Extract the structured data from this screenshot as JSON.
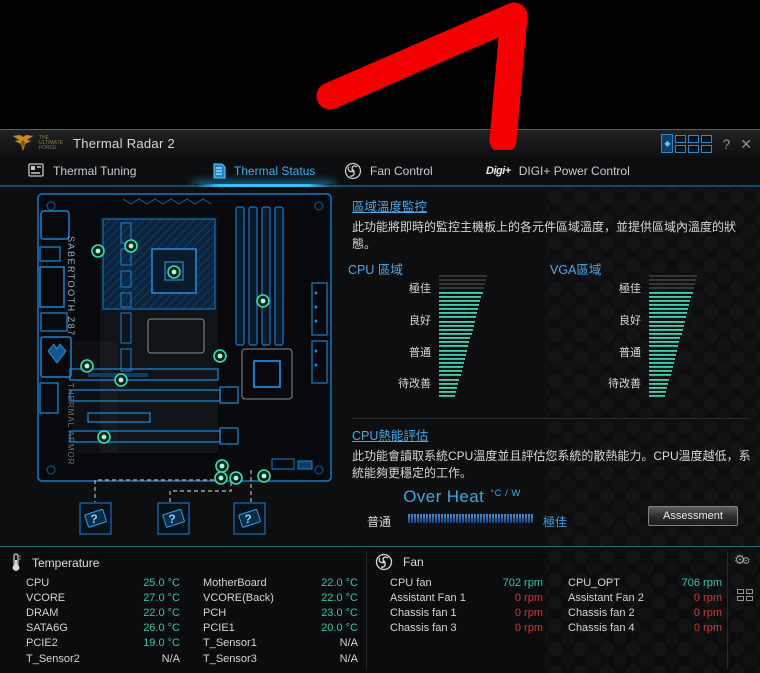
{
  "annotation": {
    "type": "arrow-stroke",
    "color": "#f40000"
  },
  "window": {
    "title": "Thermal Radar 2",
    "logo_sub": "THE ULTIMATE FORCE",
    "panel_selector_glyph": "◆",
    "controls": {
      "help": "?",
      "close": "✕"
    },
    "tabs": [
      {
        "label": "Thermal Tuning",
        "active": false
      },
      {
        "label": "Thermal Status",
        "active": true
      },
      {
        "label": "Fan Control",
        "active": false
      },
      {
        "label": "DIGI+ Power Control",
        "active": false
      }
    ],
    "digi_logo": "Digi+"
  },
  "board": {
    "name": "SABERTOOTH Z87",
    "armor_label": "THERMAL ARMOR",
    "unknown_boxes": [
      "?",
      "?",
      "?"
    ]
  },
  "region_monitor": {
    "title": "區域溫度監控",
    "description": "此功能將即時的監控主機板上的各元件區域溫度，並提供區域內溫度的狀態。",
    "meters": [
      {
        "label": "CPU 區域",
        "levels": [
          "極佳",
          "良好",
          "普通",
          "待改善"
        ]
      },
      {
        "label": "VGA區域",
        "levels": [
          "極佳",
          "良好",
          "普通",
          "待改善"
        ]
      }
    ]
  },
  "thermal_assessment": {
    "title": "CPU熱能評估",
    "description": "此功能會讀取系統CPU溫度並且評估您系統的散熱能力。CPU溫度越低，系統能夠更穩定的工作。",
    "gauge_title": "Over Heat",
    "gauge_unit": "°C / W",
    "scale_left": "普通",
    "scale_right": "極佳",
    "button_label": "Assessment"
  },
  "temperature": {
    "title": "Temperature",
    "rows": [
      {
        "l1": "CPU",
        "v1": "25.0 °C",
        "c1": "teal",
        "l2": "MotherBoard",
        "v2": "22.0 °C",
        "c2": "teal"
      },
      {
        "l1": "VCORE",
        "v1": "27.0 °C",
        "c1": "teal",
        "l2": "VCORE(Back)",
        "v2": "22.0 °C",
        "c2": "teal"
      },
      {
        "l1": "DRAM",
        "v1": "22.0 °C",
        "c1": "teal",
        "l2": "PCH",
        "v2": "23.0 °C",
        "c2": "teal"
      },
      {
        "l1": "SATA6G",
        "v1": "26.0 °C",
        "c1": "teal",
        "l2": "PCIE1",
        "v2": "20.0 °C",
        "c2": "teal"
      },
      {
        "l1": "PCIE2",
        "v1": "19.0 °C",
        "c1": "teal",
        "l2": "T_Sensor1",
        "v2": "N/A",
        "c2": "na"
      },
      {
        "l1": "T_Sensor2",
        "v1": "N/A",
        "c1": "na",
        "l2": "T_Sensor3",
        "v2": "N/A",
        "c2": "na"
      }
    ]
  },
  "fan": {
    "title": "Fan",
    "rows": [
      {
        "l1": "CPU fan",
        "v1": "702 rpm",
        "c1": "teal",
        "l2": "CPU_OPT",
        "v2": "706 rpm",
        "c2": "teal"
      },
      {
        "l1": "Assistant Fan 1",
        "v1": "0 rpm",
        "c1": "red",
        "l2": "Assistant Fan 2",
        "v2": "0 rpm",
        "c2": "red"
      },
      {
        "l1": "Chassis fan 1",
        "v1": "0 rpm",
        "c1": "red",
        "l2": "Chassis fan 2",
        "v2": "0 rpm",
        "c2": "red"
      },
      {
        "l1": "Chassis fan 3",
        "v1": "0 rpm",
        "c1": "red",
        "l2": "Chassis fan 4",
        "v2": "0 rpm",
        "c2": "red"
      }
    ]
  },
  "colors": {
    "accent_blue": "#35b5f0",
    "teal": "#35c7a4",
    "red": "#cc3b33",
    "board_blue": "#1779c4"
  }
}
